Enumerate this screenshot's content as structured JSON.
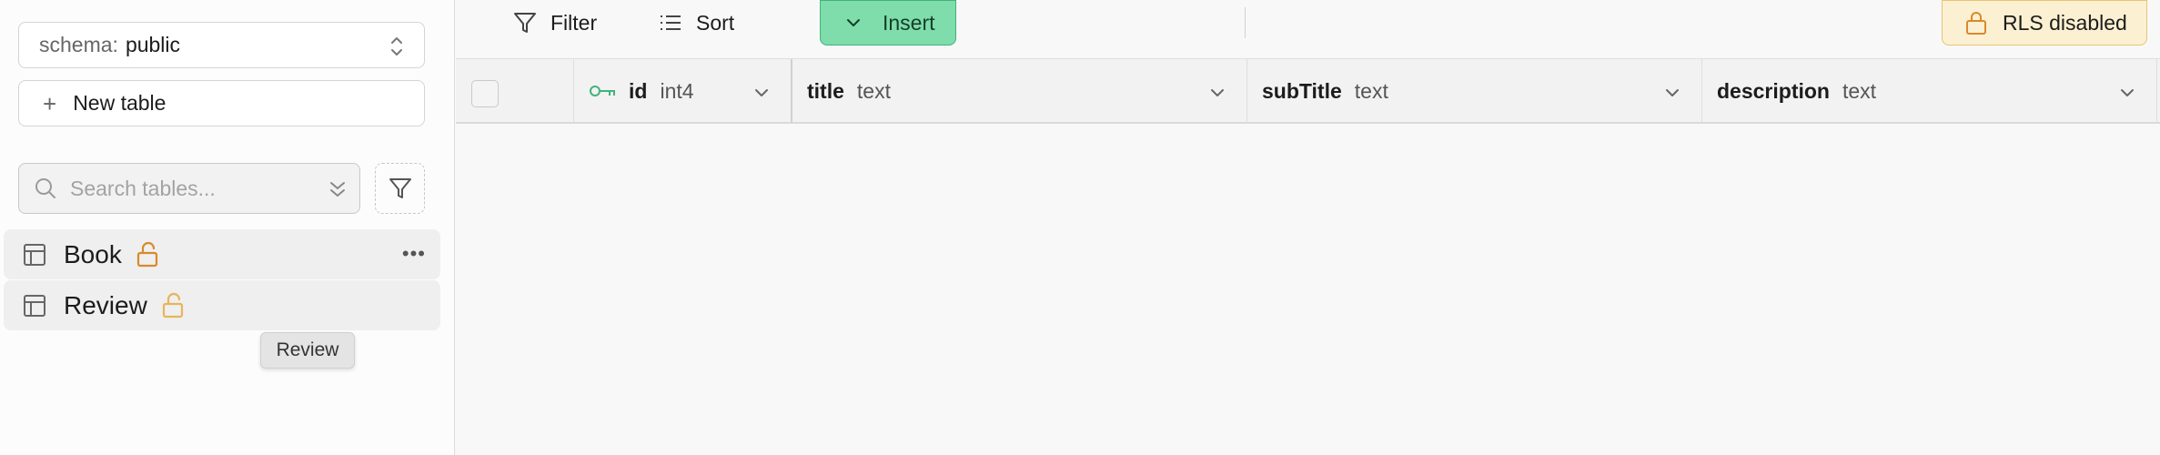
{
  "sidebar": {
    "schema_label": "schema:",
    "schema_value": "public",
    "new_table_label": "New table",
    "search_placeholder": "Search tables...",
    "tables": [
      {
        "name": "Book",
        "lock_color": "#d98a2b"
      },
      {
        "name": "Review",
        "lock_color": "#e8b45c"
      }
    ],
    "tooltip": "Review"
  },
  "toolbar": {
    "filter_label": "Filter",
    "sort_label": "Sort",
    "insert_label": "Insert",
    "rls_label": "RLS disabled"
  },
  "columns": [
    {
      "name": "id",
      "type": "int4",
      "key_icon": "key-icon"
    },
    {
      "name": "title",
      "type": "text"
    },
    {
      "name": "subTitle",
      "type": "text"
    },
    {
      "name": "description",
      "type": "text"
    }
  ],
  "colors": {
    "insert_bg": "#7fdcab",
    "rls_bg": "#fcf0d2",
    "key_icon": "#3fb37a"
  }
}
